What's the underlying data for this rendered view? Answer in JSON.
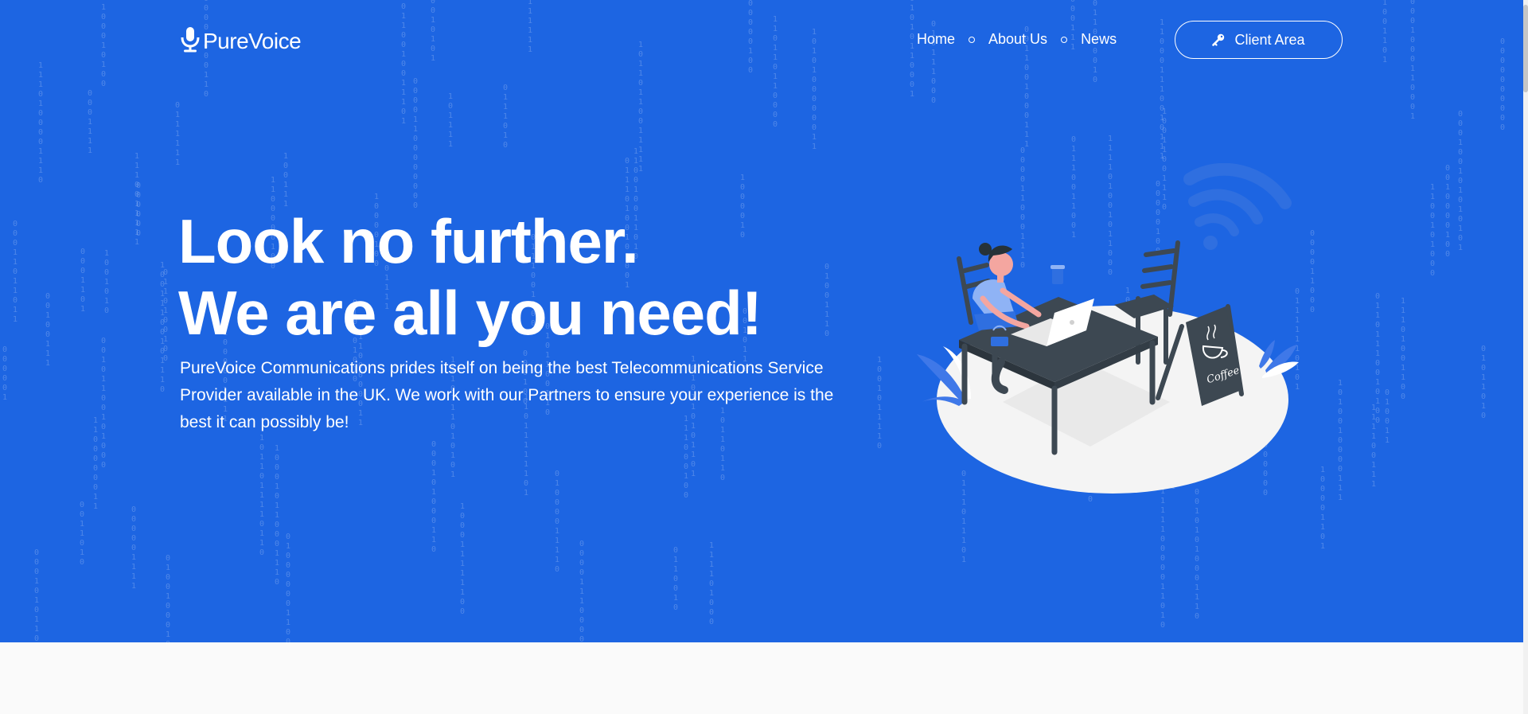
{
  "brand": {
    "name": "PureVoice",
    "colors": {
      "primary": "#1d65e2",
      "text": "#ffffff",
      "footer_bg": "#fafafa",
      "illustration_dark": "#3d4852",
      "illustration_accent": "#f4a6a0"
    }
  },
  "header": {
    "logo_icon": "microphone-icon",
    "nav": [
      {
        "label": "Home"
      },
      {
        "label": "About Us"
      },
      {
        "label": "News"
      }
    ],
    "client_area": {
      "label": "Client Area",
      "icon": "key-icon"
    }
  },
  "hero": {
    "headline_line1": "Look no further.",
    "headline_line2": "We are all you need!",
    "lead": "PureVoice Communications prides itself on being the best Telecommunications Service Provider available in the UK. We work with our Partners to ensure your experience is the best it can possibly be!",
    "illustration": {
      "sign_text": "Coffee",
      "icons": [
        "wifi-icon",
        "coffee-cup-icon",
        "laptop-icon",
        "plant-icon"
      ]
    }
  }
}
